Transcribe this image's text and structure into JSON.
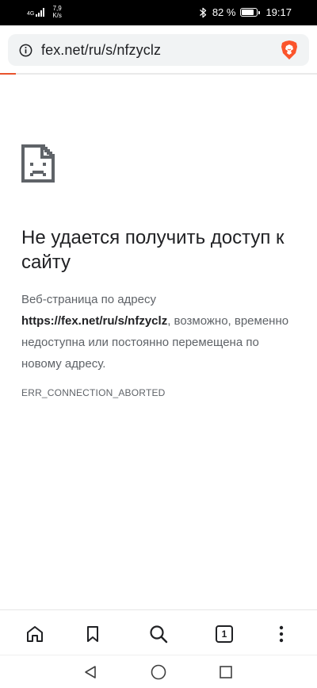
{
  "status_bar": {
    "network_type": "4G",
    "speed_value": "7,9",
    "speed_unit": "K/s",
    "battery_text": "82 %",
    "battery_level": 0.82,
    "time": "19:17"
  },
  "browser": {
    "url": "fex.net/ru/s/nfzyclz",
    "load_progress": 0.05,
    "accent_color": "#e8532d",
    "tab_count": "1"
  },
  "error": {
    "title": "Не удается получить доступ к сайту",
    "desc_prefix": "Веб-страница по адресу ",
    "desc_url": "https://fex.net/ru/s/nfzyclz",
    "desc_suffix": ", возможно, временно недоступна или постоянно перемещена по новому адресу.",
    "code": "ERR_CONNECTION_ABORTED"
  },
  "icons": {
    "info": "info-icon",
    "brave": "brave-lion-icon",
    "sad_page": "sad-page-icon",
    "home": "home-icon",
    "bookmarks": "bookmark-icon",
    "search": "search-icon",
    "menu": "more-vertical-icon",
    "back": "back-triangle-icon",
    "home_nav": "home-circle-icon",
    "recents": "recents-square-icon"
  }
}
